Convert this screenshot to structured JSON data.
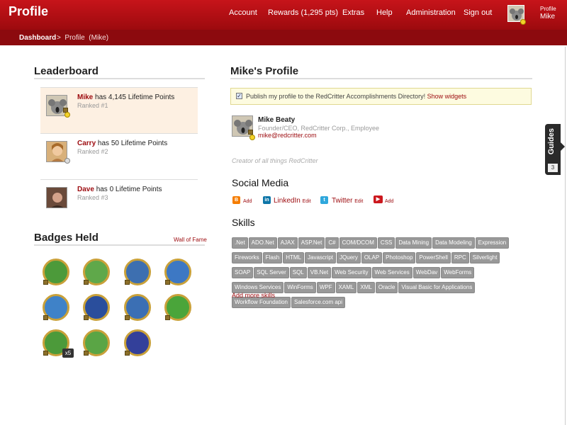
{
  "header": {
    "title": "Profile",
    "nav": [
      "Account",
      "Rewards (1,295 pts)",
      "Extras",
      "Help",
      "Administration",
      "Sign out"
    ],
    "profile_link": "Profile",
    "user": "Mike"
  },
  "breadcrumb": {
    "dashboard": "Dashboard",
    "current": ">  Profile  (Mike)"
  },
  "leaderboard": {
    "title": "Leaderboard",
    "rows": [
      {
        "name": "Mike",
        "points": "has 4,145 Lifetime Points",
        "rank": "Ranked #1"
      },
      {
        "name": "Carry",
        "points": "has 50 Lifetime Points",
        "rank": "Ranked #2"
      },
      {
        "name": "Dave",
        "points": "has 0 Lifetime Points",
        "rank": "Ranked #3"
      }
    ]
  },
  "badges": {
    "title": "Badges Held",
    "wall_link": "Wall of Fame",
    "count_label": "x5",
    "items": [
      {
        "icon": "fist-icon",
        "color": "#4c9a3a"
      },
      {
        "icon": "donkey-icon",
        "color": "#5fa84a"
      },
      {
        "icon": "compass-icon",
        "color": "#3d6fb0"
      },
      {
        "icon": "chat-bubbles-icon",
        "color": "#3d78c4"
      },
      {
        "icon": "double-check-icon",
        "color": "#3f82c8"
      },
      {
        "icon": "thirty-icon",
        "color": "#2a4e9c"
      },
      {
        "icon": "hat-icon",
        "color": "#3b6fb4"
      },
      {
        "icon": "document-icon",
        "color": "#4aa53a"
      },
      {
        "icon": "roller-skate-icon",
        "color": "#4c9a3a"
      },
      {
        "icon": "cart-icon",
        "color": "#5aa545"
      },
      {
        "icon": "cookie-icon",
        "color": "#33409a"
      }
    ]
  },
  "profile": {
    "title": "Mike's Profile",
    "publish_text": "Publish my profile to the RedCritter Accomplishments Directory!",
    "show_widgets": "Show widgets",
    "name": "Mike Beaty",
    "job": "Founder/CEO, RedCritter Corp., Employee",
    "email": "mike@redcritter.com",
    "tagline": "Creator of all things RedCritter"
  },
  "social": {
    "title": "Social Media",
    "items": [
      {
        "icon": "blogger-icon",
        "label": "",
        "action": "Add",
        "color": "#f57d00"
      },
      {
        "icon": "linkedin-icon",
        "label": "LinkedIn",
        "action": "Edit",
        "color": "#0e76a8"
      },
      {
        "icon": "twitter-icon",
        "label": "Twitter",
        "action": "Edit",
        "color": "#2fa7dc"
      },
      {
        "icon": "youtube-icon",
        "label": "",
        "action": "Add",
        "color": "#cc181e"
      }
    ]
  },
  "skills": {
    "title": "Skills",
    "items": [
      ".Net",
      "ADO.Net",
      "AJAX",
      "ASP.Net",
      "C#",
      "COM/DCOM",
      "CSS",
      "Data Mining",
      "Data Modeling",
      "Expression",
      "Fireworks",
      "Flash",
      "HTML",
      "Javascript",
      "JQuery",
      "OLAP",
      "Photoshop",
      "PowerShell",
      "RPC",
      "Silverlight",
      "SOAP",
      "SQL Server",
      "SQL",
      "VB.Net",
      "Web Security",
      "Web Services",
      "WebDav",
      "WebForms",
      "Windows Services",
      "WinForms",
      "WPF",
      "XAML",
      "XML",
      "Oracle",
      "Visual Basic for Applications",
      "Workflow Foundation",
      "Salesforce.com api"
    ],
    "add_more": "Add more skills"
  },
  "guides": {
    "label": "Guides",
    "count": "3"
  }
}
